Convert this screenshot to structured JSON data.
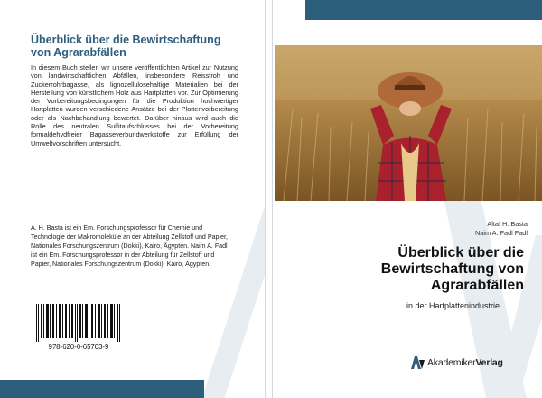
{
  "colors": {
    "brand": "#2d5f7c",
    "bg_mark": "#e8edf1"
  },
  "back": {
    "title": "Überblick über die Bewirtschaftung von Agrarabfällen",
    "blurb": "In diesem Buch stellen wir unsere veröffentlichten Artikel zur Nutzung von landwirtschaftlichen Abfällen, insbesondere Reisstroh und Zuckerrohrbagasse, als lignozellulosehaltige Materialien bei der Herstellung von künstlichem Holz aus Hartplatten vor. Zur Optimierung der Vorbereitungsbedingungen für die Produktion hochwertiger Hartplatten wurden verschiedene Ansätze bei der Plattenvorbereitung oder als Nachbehandlung bewertet. Darüber hinaus wird auch die Rolle des neutralen Sulfitaufschlusses bei der Vorbereitung formaldehydfreier Bagasseverbundwerkstoffe zur Erfüllung der Umweltvorschriften untersucht.",
    "author_bio": "A. H. Basta ist ein Em. Forschungsprofessor für Chemie und Technologie der Makromoleküle an der Abteilung Zellstoff und Papier, Nationales Forschungszentrum (Dokki), Kairo, Ägypten. Naim A. Fadl ist ein Em. Forschungsprofessor in der Abteilung für Zellstoff und Papier, Nationales Forschungszentrum (Dokki), Kairo, Ägypten.",
    "isbn": "978-620-0-65703-9"
  },
  "front": {
    "authors": [
      "Altaf H. Basta",
      "Naim A. Fadl Fadl"
    ],
    "title": "Überblick über die Bewirtschaftung von Agrarabfällen",
    "subtitle": "in der Hartplattenindustrie",
    "publisher": {
      "name_part1": "Akademiker",
      "name_part2": "Verlag"
    }
  }
}
